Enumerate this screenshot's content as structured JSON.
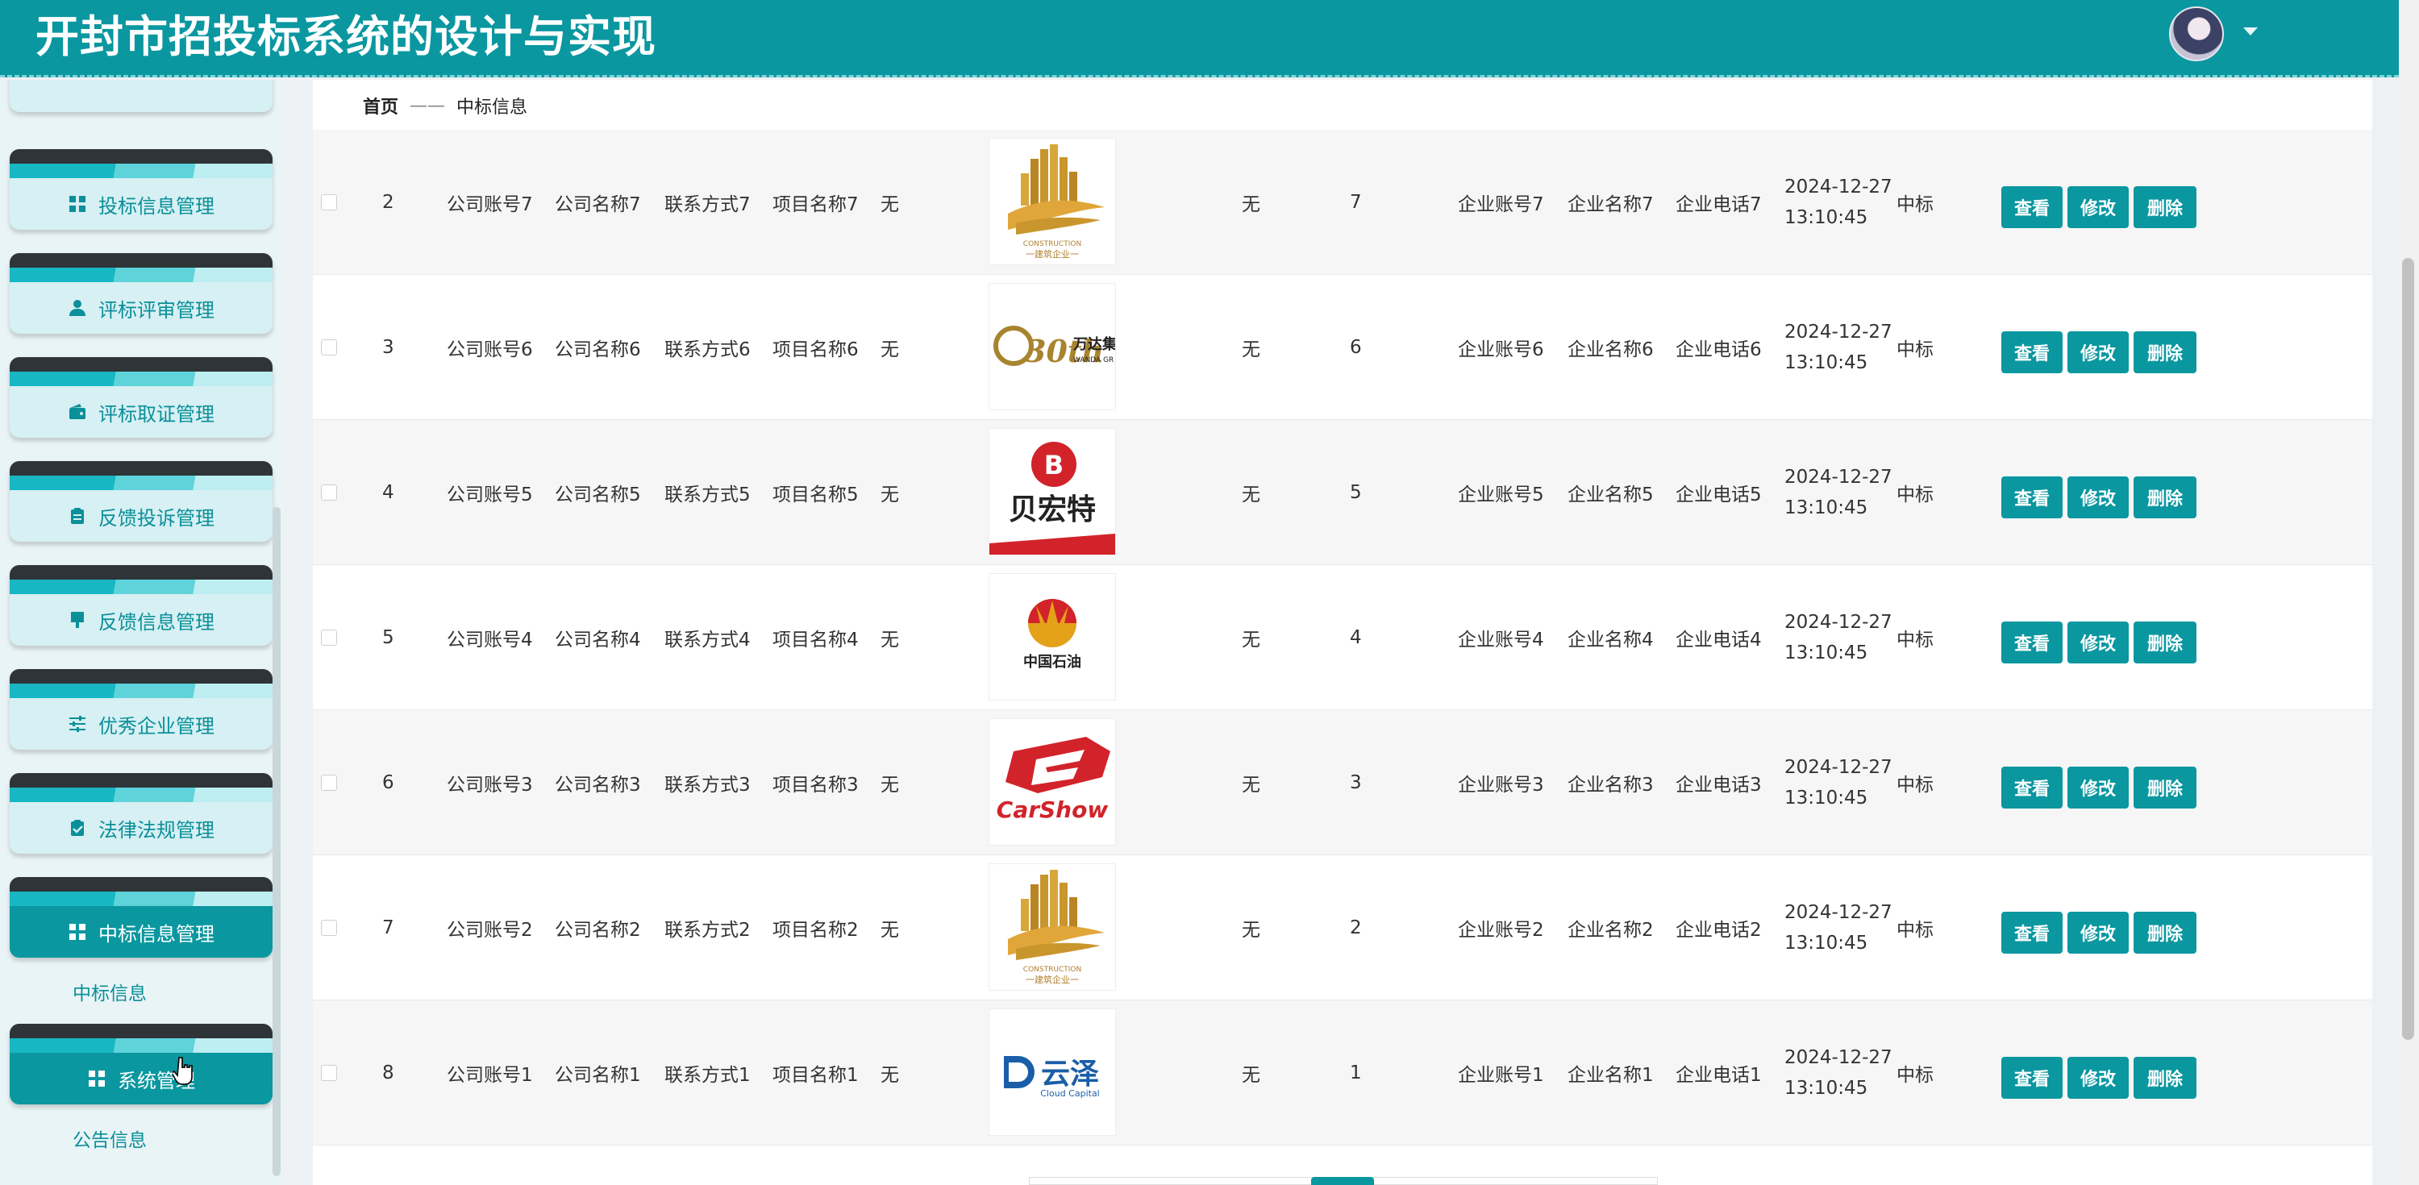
{
  "header": {
    "title": "开封市招投标系统的设计与实现"
  },
  "breadcrumb": {
    "home": "首页",
    "separator": "——",
    "current": "中标信息"
  },
  "sidebar": {
    "items": [
      {
        "label": "投标信息管理",
        "icon": "grid-icon"
      },
      {
        "label": "评标评审管理",
        "icon": "user-icon"
      },
      {
        "label": "评标取证管理",
        "icon": "wallet-icon"
      },
      {
        "label": "反馈投诉管理",
        "icon": "clipboard-icon"
      },
      {
        "label": "反馈信息管理",
        "icon": "brush-icon"
      },
      {
        "label": "优秀企业管理",
        "icon": "sliders-icon"
      },
      {
        "label": "法律法规管理",
        "icon": "clipboard-check-icon"
      },
      {
        "label": "中标信息管理",
        "icon": "grid-icon",
        "active": true
      },
      {
        "label": "系统管理",
        "icon": "grid-icon",
        "active": true
      }
    ],
    "sub_zhongbiao": "中标信息",
    "sub_system": "公告信息"
  },
  "table": {
    "rows": [
      {
        "idx": "2",
        "company_account": "公司账号7",
        "company_name": "公司名称7",
        "contact": "联系方式7",
        "project_name": "项目名称7",
        "remark": "无",
        "logo": "construction-logo",
        "remark2": "无",
        "num": "7",
        "ent_account": "企业账号7",
        "ent_name": "企业名称7",
        "ent_phone": "企业电话7",
        "date": "2024-12-27",
        "time": "13:10:45",
        "status": "中标"
      },
      {
        "idx": "3",
        "company_account": "公司账号6",
        "company_name": "公司名称6",
        "contact": "联系方式6",
        "project_name": "项目名称6",
        "remark": "无",
        "logo": "wanda-logo",
        "remark2": "无",
        "num": "6",
        "ent_account": "企业账号6",
        "ent_name": "企业名称6",
        "ent_phone": "企业电话6",
        "date": "2024-12-27",
        "time": "13:10:45",
        "status": "中标"
      },
      {
        "idx": "4",
        "company_account": "公司账号5",
        "company_name": "公司名称5",
        "contact": "联系方式5",
        "project_name": "项目名称5",
        "remark": "无",
        "logo": "beihongte-logo",
        "remark2": "无",
        "num": "5",
        "ent_account": "企业账号5",
        "ent_name": "企业名称5",
        "ent_phone": "企业电话5",
        "date": "2024-12-27",
        "time": "13:10:45",
        "status": "中标"
      },
      {
        "idx": "5",
        "company_account": "公司账号4",
        "company_name": "公司名称4",
        "contact": "联系方式4",
        "project_name": "项目名称4",
        "remark": "无",
        "logo": "petrochina-logo",
        "remark2": "无",
        "num": "4",
        "ent_account": "企业账号4",
        "ent_name": "企业名称4",
        "ent_phone": "企业电话4",
        "date": "2024-12-27",
        "time": "13:10:45",
        "status": "中标"
      },
      {
        "idx": "6",
        "company_account": "公司账号3",
        "company_name": "公司名称3",
        "contact": "联系方式3",
        "project_name": "项目名称3",
        "remark": "无",
        "logo": "carshow-logo",
        "remark2": "无",
        "num": "3",
        "ent_account": "企业账号3",
        "ent_name": "企业名称3",
        "ent_phone": "企业电话3",
        "date": "2024-12-27",
        "time": "13:10:45",
        "status": "中标"
      },
      {
        "idx": "7",
        "company_account": "公司账号2",
        "company_name": "公司名称2",
        "contact": "联系方式2",
        "project_name": "项目名称2",
        "remark": "无",
        "logo": "construction-logo",
        "remark2": "无",
        "num": "2",
        "ent_account": "企业账号2",
        "ent_name": "企业名称2",
        "ent_phone": "企业电话2",
        "date": "2024-12-27",
        "time": "13:10:45",
        "status": "中标"
      },
      {
        "idx": "8",
        "company_account": "公司账号1",
        "company_name": "公司名称1",
        "contact": "联系方式1",
        "project_name": "项目名称1",
        "remark": "无",
        "logo": "yunze-logo",
        "remark2": "无",
        "num": "1",
        "ent_account": "企业账号1",
        "ent_name": "企业名称1",
        "ent_phone": "企业电话1",
        "date": "2024-12-27",
        "time": "13:10:45",
        "status": "中标"
      }
    ],
    "actions": {
      "view": "查看",
      "edit": "修改",
      "delete": "删除"
    }
  },
  "logos": {
    "construction_caption": "CONSTRUCTION",
    "construction_sub": "一建筑企业一",
    "wanda_text": "万达集",
    "wanda_sub": "WANDA GR",
    "wanda_30": "30th",
    "beihongte_text": "贝宏特",
    "petrochina_text": "中国石油",
    "carshow_text": "CarShow",
    "yunze_text": "云泽",
    "yunze_sub": "Cloud Capital"
  },
  "colors": {
    "primary": "#0a97a0",
    "menu_bg": "#d6f0f3",
    "band_dark": "#2f3438"
  }
}
